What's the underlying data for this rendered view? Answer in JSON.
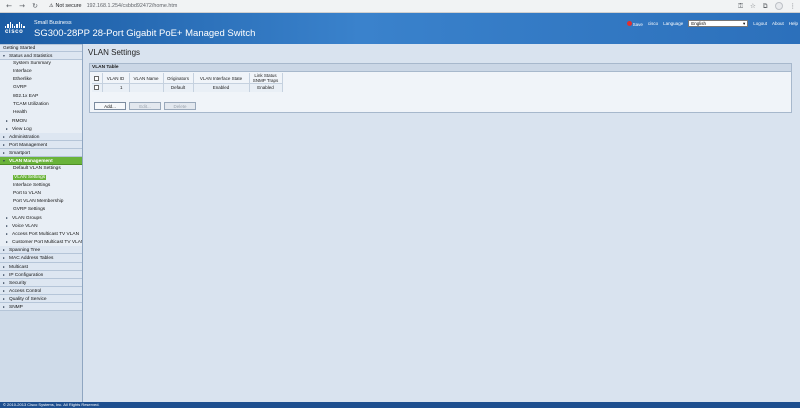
{
  "browser": {
    "security_label": "Not secure",
    "url": "192.168.1.254/csbbd92472/home.htm"
  },
  "header": {
    "small_business": "Small Business",
    "product_name": "SG300-28PP 28-Port Gigabit PoE+ Managed Switch",
    "logo_text": "cisco",
    "links": {
      "save": "Save",
      "user": "cisco",
      "language": "Language",
      "logout": "Logout",
      "about": "About",
      "help": "Help"
    },
    "language_value": "English"
  },
  "sidebar": {
    "items": [
      {
        "label": "Getting Started",
        "kind": "section-plain"
      },
      {
        "label": "Status and Statistics",
        "kind": "section-open"
      },
      {
        "label": "System Summary",
        "kind": "sub"
      },
      {
        "label": "Interface",
        "kind": "sub"
      },
      {
        "label": "Etherlike",
        "kind": "sub"
      },
      {
        "label": "GVRP",
        "kind": "sub"
      },
      {
        "label": "802.1x EAP",
        "kind": "sub"
      },
      {
        "label": "TCAM Utilization",
        "kind": "sub"
      },
      {
        "label": "Health",
        "kind": "sub"
      },
      {
        "label": "RMON",
        "kind": "sub-exp"
      },
      {
        "label": "View Log",
        "kind": "sub-exp"
      },
      {
        "label": "Administration",
        "kind": "section"
      },
      {
        "label": "Port Management",
        "kind": "section"
      },
      {
        "label": "Smartport",
        "kind": "section"
      },
      {
        "label": "VLAN Management",
        "kind": "active"
      },
      {
        "label": "Default VLAN Settings",
        "kind": "sub"
      },
      {
        "label": "VLAN Settings",
        "kind": "current"
      },
      {
        "label": "Interface Settings",
        "kind": "sub"
      },
      {
        "label": "Port to VLAN",
        "kind": "sub"
      },
      {
        "label": "Port VLAN Membership",
        "kind": "sub"
      },
      {
        "label": "GVRP Settings",
        "kind": "sub"
      },
      {
        "label": "VLAN Groups",
        "kind": "sub-exp"
      },
      {
        "label": "Voice VLAN",
        "kind": "sub-exp"
      },
      {
        "label": "Access Port Multicast TV VLAN",
        "kind": "sub-exp"
      },
      {
        "label": "Customer Port Multicast TV VLAN",
        "kind": "sub-exp"
      },
      {
        "label": "Spanning Tree",
        "kind": "section"
      },
      {
        "label": "MAC Address Tables",
        "kind": "section"
      },
      {
        "label": "Multicast",
        "kind": "section"
      },
      {
        "label": "IP Configuration",
        "kind": "section"
      },
      {
        "label": "Security",
        "kind": "section"
      },
      {
        "label": "Access Control",
        "kind": "section"
      },
      {
        "label": "Quality of Service",
        "kind": "section"
      },
      {
        "label": "SNMP",
        "kind": "section"
      }
    ]
  },
  "main": {
    "title": "VLAN Settings",
    "table_title": "VLAN Table",
    "columns": [
      "VLAN ID",
      "VLAN Name",
      "Originators",
      "VLAN Interface State",
      "Link Status"
    ],
    "extra_header": "SNMP Traps",
    "rows": [
      {
        "id": "1",
        "name": "",
        "originators": "Default",
        "interface_state": "Enabled",
        "link_status": "Enabled"
      }
    ],
    "buttons": {
      "add": "Add...",
      "edit": "Edit...",
      "delete": "Delete"
    }
  },
  "footer": {
    "text": "© 2010-2013 Cisco Systems, Inc. All Rights Reserved."
  }
}
